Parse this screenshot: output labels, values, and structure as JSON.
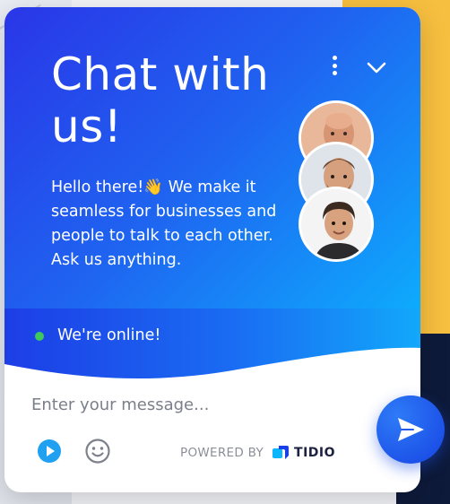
{
  "header": {
    "title": "Chat with us!",
    "greeting": "Hello there!👋 We make it seamless for businesses and people to talk to each other. Ask us anything.",
    "menu_icon": "more-vertical-icon",
    "collapse_icon": "chevron-down-icon"
  },
  "status": {
    "text": "We're online!",
    "dot_color": "#3ec95a"
  },
  "composer": {
    "placeholder": "Enter your message...",
    "attach_icon": "play-circle-icon",
    "emoji_icon": "smiley-icon",
    "send_icon": "paper-plane-icon"
  },
  "branding": {
    "powered_by": "POWERED BY",
    "brand": "TIDIO"
  },
  "colors": {
    "header_start": "#2a36e8",
    "header_end": "#0bb6ff",
    "send_button": "#1643e3",
    "background_yellow": "#f7bf3f",
    "background_navy": "#0e1a3a"
  }
}
